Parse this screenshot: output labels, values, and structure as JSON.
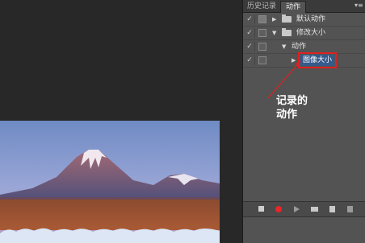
{
  "panel": {
    "tabs": [
      {
        "label": "历史记录",
        "active": false
      },
      {
        "label": "动作",
        "active": true
      }
    ],
    "menu_icon": "panel-menu-icon",
    "collapse_icon": "double-chevron-right-icon"
  },
  "actions": [
    {
      "label": "默认动作",
      "type": "set",
      "checked": true,
      "expanded": false
    },
    {
      "label": "修改大小",
      "type": "set",
      "checked": true,
      "expanded": true
    },
    {
      "label": "动作",
      "type": "action",
      "checked": true,
      "expanded": true
    },
    {
      "label": "图像大小",
      "type": "step",
      "checked": true,
      "selected": true
    }
  ],
  "footer": {
    "buttons": [
      {
        "name": "stop-button",
        "icon": "stop-icon"
      },
      {
        "name": "record-button",
        "icon": "record-icon"
      },
      {
        "name": "play-button",
        "icon": "play-icon"
      },
      {
        "name": "new-set-button",
        "icon": "folder-icon"
      },
      {
        "name": "new-action-button",
        "icon": "new-item-icon"
      },
      {
        "name": "delete-button",
        "icon": "trash-icon"
      }
    ]
  },
  "annotation": {
    "line1": "记录的",
    "line2": "动作",
    "color": "#e02020"
  },
  "colors": {
    "workspace": "#282828",
    "panel": "#535353",
    "selected": "#375a8c",
    "record": "#e8252a"
  }
}
